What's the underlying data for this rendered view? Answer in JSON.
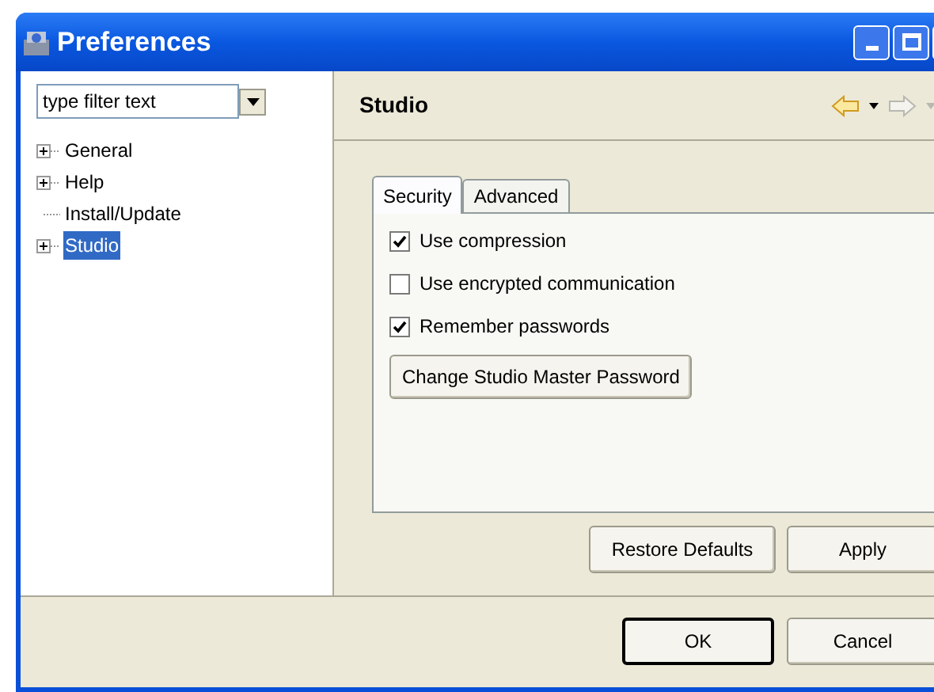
{
  "window": {
    "title": "Preferences"
  },
  "filter": {
    "placeholder": "type filter text"
  },
  "tree": [
    {
      "label": "General",
      "kind": "folder",
      "selected": false
    },
    {
      "label": "Help",
      "kind": "folder",
      "selected": false
    },
    {
      "label": "Install/Update",
      "kind": "leaf",
      "selected": false
    },
    {
      "label": "Studio",
      "kind": "folder",
      "selected": true
    }
  ],
  "page": {
    "title": "Studio"
  },
  "tabs": [
    {
      "label": "Security",
      "selected": true
    },
    {
      "label": "Advanced",
      "selected": false
    }
  ],
  "options": [
    {
      "label": "Use compression",
      "checked": true
    },
    {
      "label": "Use encrypted communication",
      "checked": false
    },
    {
      "label": "Remember passwords",
      "checked": true
    }
  ],
  "panel_button": "Change Studio Master Password",
  "page_buttons": [
    "Restore Defaults",
    "Apply"
  ],
  "dialog_buttons": [
    {
      "label": "OK",
      "default": true
    },
    {
      "label": "Cancel",
      "default": false
    }
  ]
}
